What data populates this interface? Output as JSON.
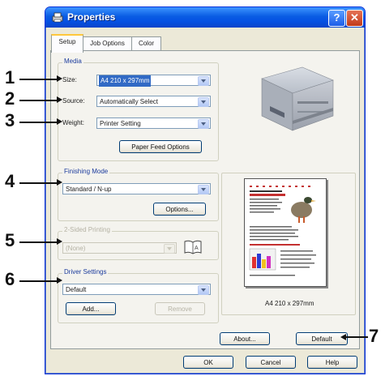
{
  "window": {
    "title": "Properties",
    "help_glyph": "?",
    "close_glyph": "✕"
  },
  "tabs": [
    {
      "label": "Setup"
    },
    {
      "label": "Job Options"
    },
    {
      "label": "Color"
    }
  ],
  "media": {
    "group_label": "Media",
    "size_label": "Size:",
    "size_value": "A4 210 x 297mm",
    "source_label": "Source:",
    "source_value": "Automatically Select",
    "weight_label": "Weight:",
    "weight_value": "Printer Setting",
    "paper_feed_button": "Paper Feed Options"
  },
  "finishing": {
    "group_label": "Finishing Mode",
    "mode_value": "Standard / N-up",
    "options_button": "Options..."
  },
  "second_group": {
    "group_label": "2-Sided Printing",
    "value": "(None)"
  },
  "driver": {
    "group_label": "Driver Settings",
    "value": "Default",
    "add_button": "Add...",
    "remove_button": "Remove"
  },
  "preview": {
    "caption": "A4 210 x 297mm"
  },
  "buttons": {
    "about": "About...",
    "default": "Default",
    "ok": "OK",
    "cancel": "Cancel",
    "help": "Help"
  },
  "callouts": [
    "1",
    "2",
    "3",
    "4",
    "5",
    "6",
    "7"
  ],
  "colors": {
    "titlebar": "#0a5ce3",
    "selection": "#316ac5",
    "dialog_bg": "#ece9d8"
  }
}
